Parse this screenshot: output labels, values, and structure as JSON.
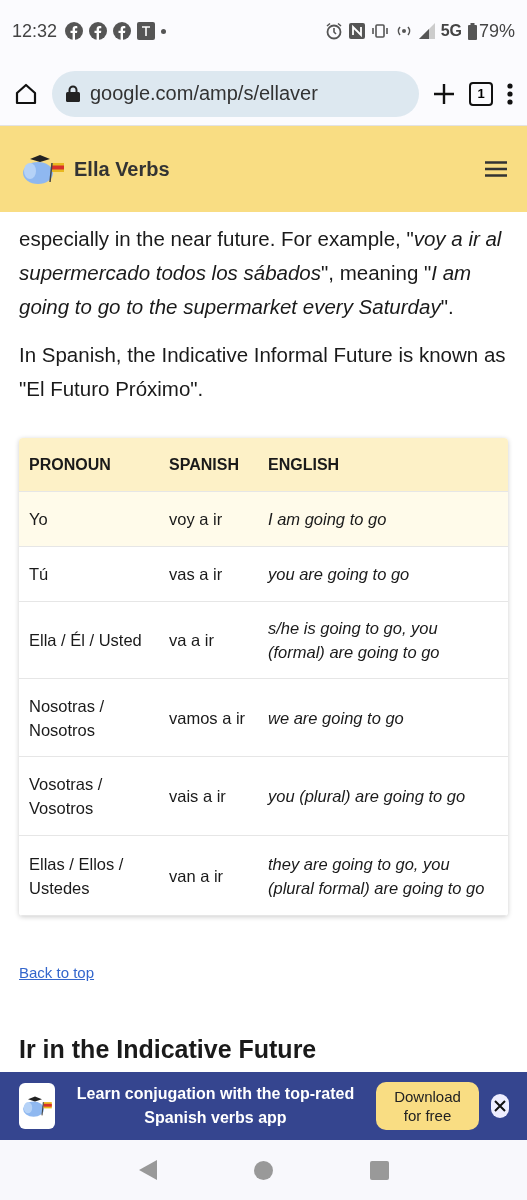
{
  "status_bar": {
    "time": "12:32",
    "network": "5G",
    "battery": "79%"
  },
  "browser": {
    "url": "google.com/amp/s/ellaver",
    "tab_count": "1"
  },
  "site_header": {
    "brand": "Ella Verbs"
  },
  "intro": [
    "especially in the near future. For example, \"*voy a ir al supermercado todos los sábados*\", meaning \"*I am going to go to the supermarket every Saturday*\".",
    "In Spanish, the Indicative Informal Future is known as \"El Futuro Próximo\"."
  ],
  "table": {
    "columns": [
      "PRONOUN",
      "SPANISH",
      "ENGLISH"
    ],
    "rows": [
      {
        "pronoun": "Yo",
        "spanish": "voy a ir",
        "english": "I am going to go",
        "highlighted": true
      },
      {
        "pronoun": "Tú",
        "spanish": "vas a ir",
        "english": "you are going to go",
        "highlighted": false
      },
      {
        "pronoun": "Ella / Él / Usted",
        "spanish": "va a ir",
        "english": "s/he is going to go, you (formal) are going to go",
        "highlighted": false
      },
      {
        "pronoun": "Nosotras / Nosotros",
        "spanish": "vamos a ir",
        "english": "we are going to go",
        "highlighted": false
      },
      {
        "pronoun": "Vosotras / Vosotros",
        "spanish": "vais a ir",
        "english": "you (plural) are going to go",
        "highlighted": false
      },
      {
        "pronoun": "Ellas / Ellos / Ustedes",
        "spanish": "van a ir",
        "english": "they are going to go, you (plural formal) are going to go",
        "highlighted": false
      }
    ]
  },
  "back_link": "Back to top",
  "next_heading": "Ir in the Indicative Future",
  "app_banner": {
    "text": "Learn conjugation with the top-rated Spanish verbs app",
    "button": "Download for free"
  }
}
